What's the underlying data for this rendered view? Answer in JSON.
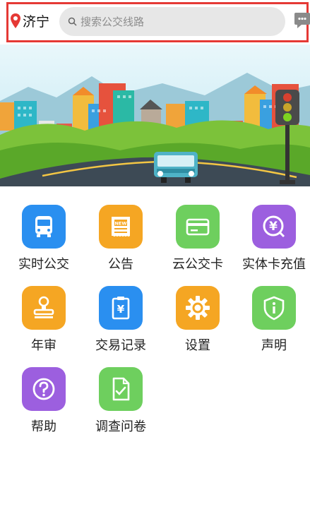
{
  "header": {
    "city": "济宁",
    "search_placeholder": "搜索公交线路"
  },
  "menu": [
    {
      "label": "实时公交",
      "icon": "bus-icon",
      "color": "#2a8ff0"
    },
    {
      "label": "公告",
      "icon": "newspaper-icon",
      "color": "#f5a623"
    },
    {
      "label": "云公交卡",
      "icon": "card-icon",
      "color": "#6ecf5e"
    },
    {
      "label": "实体卡充值",
      "icon": "yen-recharge-icon",
      "color": "#9c5fdf"
    },
    {
      "label": "年审",
      "icon": "stamp-icon",
      "color": "#f5a623"
    },
    {
      "label": "交易记录",
      "icon": "receipt-icon",
      "color": "#2a8ff0"
    },
    {
      "label": "设置",
      "icon": "gear-icon",
      "color": "#f5a623"
    },
    {
      "label": "声明",
      "icon": "shield-icon",
      "color": "#6ecf5e"
    },
    {
      "label": "帮助",
      "icon": "help-icon",
      "color": "#9c5fdf"
    },
    {
      "label": "调查问卷",
      "icon": "survey-icon",
      "color": "#6ecf5e"
    }
  ]
}
